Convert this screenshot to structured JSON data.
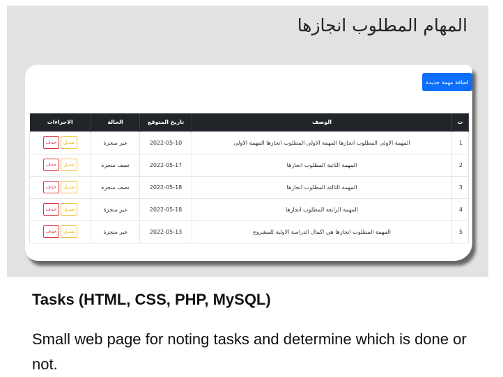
{
  "app": {
    "heading": "المهام المطلوب انجازها",
    "add_button": "اضافة مهمة جديدة"
  },
  "table": {
    "headers": {
      "num": "ت",
      "desc": "الوصف",
      "date": "تاريخ المتوقع",
      "state": "الحالة",
      "actions": "الاجراءات"
    },
    "rows": [
      {
        "num": "1",
        "desc": "المهمة الاولى المطلوب انجازها المهمة الاولى المطلوب انجازها المهمة الاولى",
        "date": "2022-05-10",
        "state": "غير منجزة",
        "edit": "تعديل",
        "delete": "حذف"
      },
      {
        "num": "2",
        "desc": "المهمة الثانية المطلوب انجازها",
        "date": "2022-05-17",
        "state": "نصف منجزة",
        "edit": "تعديل",
        "delete": "حذف"
      },
      {
        "num": "3",
        "desc": "المهمة الثالثة المطلوب انجازها",
        "date": "2022-05-18",
        "state": "نصف منجزة",
        "edit": "تعديل",
        "delete": "حذف"
      },
      {
        "num": "4",
        "desc": "المهمة الرابعة المطلوب انجازها",
        "date": "2022-05-18",
        "state": "غير منجزة",
        "edit": "تعديل",
        "delete": "حذف"
      },
      {
        "num": "5",
        "desc": "المهمة المطلوب انجازها هي اكمال الدراسة الاولية للمشروع",
        "date": "2022-05-13",
        "state": "غير منجزة",
        "edit": "تعديل",
        "delete": "حذف"
      }
    ]
  },
  "caption": {
    "title": "Tasks (HTML, CSS, PHP, MySQL)",
    "description": "Small web page for noting tasks and determine which is done or not."
  }
}
